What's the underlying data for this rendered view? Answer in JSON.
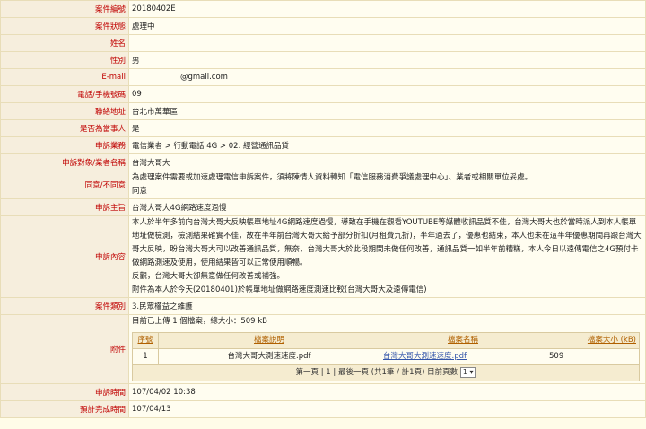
{
  "case_no": {
    "label": "案件編號",
    "value": "20180402E"
  },
  "case_status": {
    "label": "案件狀態",
    "value": "處理中"
  },
  "name": {
    "label": "姓名",
    "value": ""
  },
  "gender": {
    "label": "性別",
    "value": "男"
  },
  "email": {
    "label": "E-mail",
    "value": "@gmail.com"
  },
  "phone": {
    "label": "電話/手機號碼",
    "value": "09"
  },
  "address": {
    "label": "聯絡地址",
    "value": "台北市萬華區"
  },
  "is_party": {
    "label": "是否為當事人",
    "value": "是"
  },
  "category": {
    "label": "申訴業務",
    "value": "電信業者 > 行動電話 4G > 02. 經營通訊品質"
  },
  "target": {
    "label": "申訴對象/業者名稱",
    "value": "台灣大哥大"
  },
  "consent": {
    "label": "同意/不同意",
    "line1": "為處理案件需要或加速處理電信申訴案件，須將陳情人資料轉知「電信服務消費爭議處理中心」、業者或相關單位妥處。",
    "line2": "同意"
  },
  "subject": {
    "label": "申訴主旨",
    "value": "台灣大哥大4G網路速度過慢"
  },
  "content": {
    "label": "申訴內容",
    "p1": "本人於半年多前向台灣大哥大反映帳單地址4G網路速度過慢，導致在手機在觀看YOUTUBE等媒體收訊品質不佳，台灣大哥大也於當時派人到本人帳單地址做檢測，檢測結果確實不佳，故在半年前台灣大哥大給予部分折扣(月租費九折)，半年過去了，優惠也結束，本人也未在這半年優惠期間再跟台灣大哥大反映，盼台灣大哥大可以改善通訊品質，無奈，台灣大哥大於此段期間未做任何改善，通訊品質一如半年前糟糕，本人今日以遠傳電信之4G預付卡做網路測速及使用，使用結果皆可以正常使用順暢。",
    "p2": "反觀，台灣大哥大卻無意做任何改善或補強。",
    "p3": "附件為本人於今天(20180401)於帳單地址做網路速度測速比較(台灣大哥大及遠傳電信)"
  },
  "case_type": {
    "label": "案件類別",
    "value": "3.民眾權益之維護"
  },
  "attachments": {
    "label": "附件",
    "summary": "目前已上傳 1 個檔案，總大小：509 kB",
    "headers": {
      "no": "序號",
      "desc": "檔案說明",
      "file": "檔案名稱",
      "size": "檔案大小 (kB)"
    },
    "rows": [
      {
        "no": "1",
        "desc": "台灣大哥大測速速度.pdf",
        "file": "台灣大哥大測速速度.pdf",
        "size": "509"
      }
    ],
    "pager_text": "第一頁 | 1 | 最後一頁 (共1筆 / 計1頁) 目前頁數",
    "page_select": "1"
  },
  "submit_time": {
    "label": "申訴時間",
    "value": "107/04/02 10:38"
  },
  "expected_time": {
    "label": "預計完成時間",
    "value": "107/04/13"
  }
}
